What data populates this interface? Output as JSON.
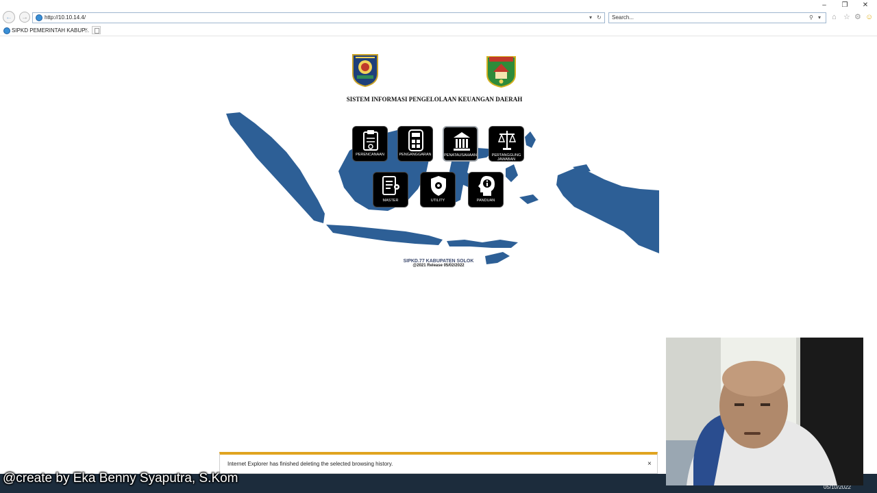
{
  "browser": {
    "address_url": "http://10.10.14.4/",
    "search_placeholder": "Search...",
    "tab_title": "SIPKD PEMERINTAH KABUP...",
    "tab_close": "×",
    "window_controls": [
      "–",
      "❐",
      "✕"
    ]
  },
  "page": {
    "title": "SISTEM INFORMASI PENGELOLAAN KEUANGAN DAERAH",
    "menu": [
      {
        "label": "PERENCANAAN",
        "icon": "clipboard-icon"
      },
      {
        "label": "PENGANGGARAN",
        "icon": "calculator-icon"
      },
      {
        "label": "PENATAUSAHAAN",
        "icon": "bank-building-icon"
      },
      {
        "label": "PERTANGGUNG JAWABAN",
        "icon": "scales-icon"
      },
      {
        "label": "MASTER",
        "icon": "document-gear-icon"
      },
      {
        "label": "UTILITY",
        "icon": "shield-gear-icon"
      },
      {
        "label": "PANDUAN",
        "icon": "info-head-icon"
      }
    ],
    "footer_line1": "SIPKD.77 KABUPATEN SOLOK",
    "footer_line2": "@2021 Release 05/02/2022",
    "map_color": "#2d5f96"
  },
  "notification": {
    "text": "Internet Explorer has finished deleting the selected browsing history.",
    "close": "×"
  },
  "taskbar": {
    "date": "05/10/2022"
  },
  "overlay": {
    "watermark": "@create by Eka Benny Syaputra, S.Kom"
  }
}
